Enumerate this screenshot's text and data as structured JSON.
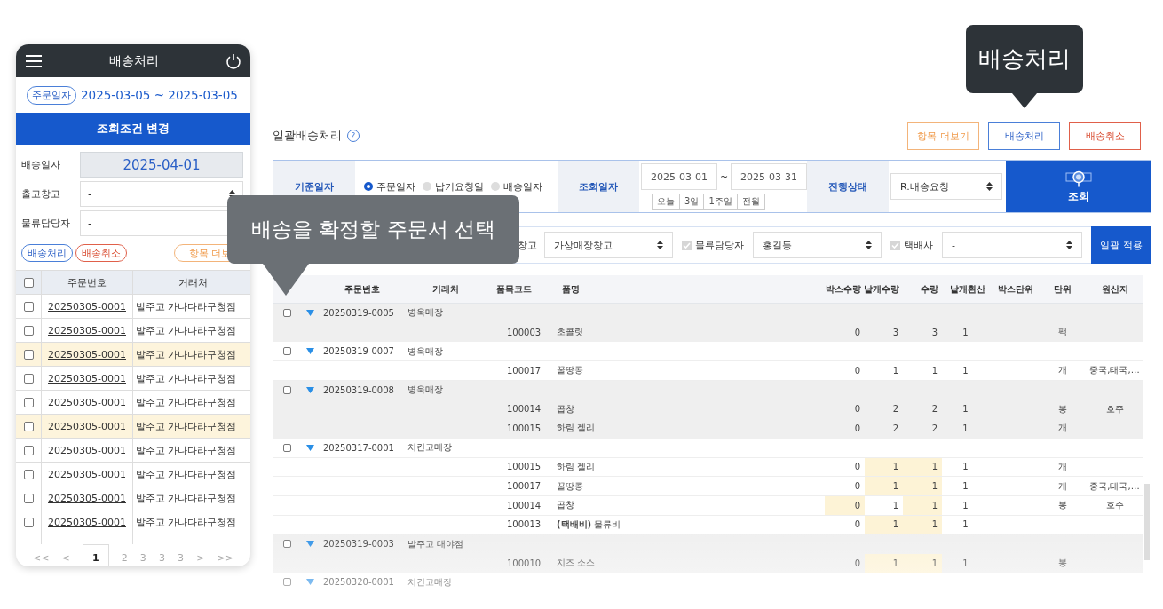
{
  "mobile": {
    "title": "배송처리",
    "date_filter": {
      "label": "주문일자",
      "range": "2025-03-05 ~ 2025-03-05"
    },
    "change_button": "조회조건 변경",
    "fields": [
      {
        "label": "배송일자",
        "value": "2025-04-01",
        "kind": "date"
      },
      {
        "label": "출고창고",
        "value": "-",
        "kind": "select"
      },
      {
        "label": "물류담당자",
        "value": "-",
        "kind": "text"
      }
    ],
    "buttons": [
      {
        "label": "배송처리",
        "kind": "primary"
      },
      {
        "label": "배송취소",
        "kind": "danger"
      },
      {
        "label": "항목 더보",
        "kind": "more"
      }
    ],
    "table": {
      "header_checked": false,
      "columns": [
        "주문번호",
        "거래처"
      ],
      "rows": [
        {
          "checked": false,
          "highlighted": false,
          "order_no": "20250305-0001",
          "customer": "발주고 가나다라구청점"
        },
        {
          "checked": false,
          "highlighted": false,
          "order_no": "20250305-0001",
          "customer": "발주고 가나다라구청점"
        },
        {
          "checked": false,
          "highlighted": true,
          "order_no": "20250305-0001",
          "customer": "발주고 가나다라구청점"
        },
        {
          "checked": false,
          "highlighted": false,
          "order_no": "20250305-0001",
          "customer": "발주고 가나다라구청점"
        },
        {
          "checked": false,
          "highlighted": false,
          "order_no": "20250305-0001",
          "customer": "발주고 가나다라구청점"
        },
        {
          "checked": false,
          "highlighted": true,
          "order_no": "20250305-0001",
          "customer": "발주고 가나다라구청점"
        },
        {
          "checked": false,
          "highlighted": false,
          "order_no": "20250305-0001",
          "customer": "발주고 가나다라구청점"
        },
        {
          "checked": false,
          "highlighted": false,
          "order_no": "20250305-0001",
          "customer": "발주고 가나다라구청점"
        },
        {
          "checked": false,
          "highlighted": false,
          "order_no": "20250305-0001",
          "customer": "발주고 가나다라구청점"
        },
        {
          "checked": false,
          "highlighted": false,
          "order_no": "20250305-0001",
          "customer": "발주고 가나다라구청점"
        }
      ]
    },
    "pagination": [
      {
        "label": "<<",
        "selected": false
      },
      {
        "label": "<",
        "selected": false
      },
      {
        "label": "1",
        "selected": true
      },
      {
        "label": "2",
        "selected": false
      },
      {
        "label": "3",
        "selected": false
      },
      {
        "label": "3",
        "selected": false
      },
      {
        "label": "3",
        "selected": false
      },
      {
        "label": ">",
        "selected": false
      },
      {
        "label": ">>",
        "selected": false
      }
    ]
  },
  "main": {
    "title": "일괄배송처리",
    "help": "?",
    "actions": [
      {
        "label": "항목 더보기",
        "kind": "more"
      },
      {
        "label": "배송처리",
        "kind": "primary"
      },
      {
        "label": "배송취소",
        "kind": "danger"
      }
    ],
    "filters": {
      "base_date": {
        "label": "기준일자",
        "options": [
          {
            "label": "주문일자",
            "selected": true
          },
          {
            "label": "납기요청일",
            "selected": false
          },
          {
            "label": "배송일자",
            "selected": false
          }
        ]
      },
      "query_date": {
        "label": "조회일자",
        "from": "2025-03-01",
        "separator": "~",
        "to": "2025-03-31",
        "quick": [
          "오늘",
          "3일",
          "1주일",
          "전월"
        ]
      },
      "status": {
        "label": "진행상태",
        "value": "R.배송요청"
      },
      "search_button": "조회"
    },
    "bulk": {
      "warehouse": {
        "label": "창고",
        "value": "가상매장창고"
      },
      "manager": {
        "label": "물류담당자",
        "checked": true,
        "value": "홍길동"
      },
      "courier": {
        "label": "택배사",
        "checked": true,
        "value": "-"
      },
      "apply_button": "일괄 적용"
    },
    "table": {
      "columns": [
        "주문번호",
        "거래처",
        "품목코드",
        "품명",
        "박스수량",
        "낱개수량",
        "수량",
        "낱개환산",
        "박스단위",
        "단위",
        "원산지"
      ],
      "orders": [
        {
          "checked": false,
          "order_no": "20250319-0005",
          "customer": "병욱매장",
          "items": [
            {
              "code": "100003",
              "name": "초콜릿",
              "box_qty": "0",
              "unit_qty": "3",
              "qty": "3",
              "unit_conv": "1",
              "unit": "팩",
              "edited": {
                "box_qty": false,
                "unit_qty": false,
                "qty": false
              }
            }
          ]
        },
        {
          "checked": false,
          "order_no": "20250319-0007",
          "customer": "병욱매장",
          "items": [
            {
              "code": "100017",
              "name": "꿀땅콩",
              "box_qty": "0",
              "unit_qty": "1",
              "qty": "1",
              "unit_conv": "1",
              "unit": "개",
              "origin": "중국,태국,…",
              "edited": {
                "box_qty": false,
                "unit_qty": false,
                "qty": false
              }
            }
          ]
        },
        {
          "checked": false,
          "order_no": "20250319-0008",
          "customer": "병욱매장",
          "items": [
            {
              "code": "100014",
              "name": "곱창",
              "box_qty": "0",
              "unit_qty": "2",
              "qty": "2",
              "unit_conv": "1",
              "unit": "봉",
              "origin": "호주",
              "edited": {
                "box_qty": false,
                "unit_qty": false,
                "qty": false
              }
            },
            {
              "code": "100015",
              "name": "하림 젤리",
              "box_qty": "0",
              "unit_qty": "2",
              "qty": "2",
              "unit_conv": "1",
              "unit": "개",
              "edited": {
                "box_qty": false,
                "unit_qty": false,
                "qty": false
              }
            }
          ]
        },
        {
          "checked": false,
          "order_no": "20250317-0001",
          "customer": "치킨고매장",
          "items": [
            {
              "code": "100015",
              "name": "하림 젤리",
              "box_qty": "0",
              "unit_qty": "1",
              "qty": "1",
              "unit_conv": "1",
              "unit": "개",
              "edited": {
                "box_qty": false,
                "unit_qty": true,
                "qty": true
              }
            },
            {
              "code": "100017",
              "name": "꿀땅콩",
              "box_qty": "0",
              "unit_qty": "1",
              "qty": "1",
              "unit_conv": "1",
              "unit": "개",
              "origin": "중국,태국,…",
              "edited": {
                "box_qty": false,
                "unit_qty": true,
                "qty": true
              }
            },
            {
              "code": "100014",
              "name": "곱창",
              "box_qty": "0",
              "unit_qty": "1",
              "qty": "1",
              "unit_conv": "1",
              "unit": "봉",
              "origin": "호주",
              "edited": {
                "box_qty": true,
                "unit_qty": false,
                "qty": true
              }
            },
            {
              "code": "100013",
              "name": "**(택배비)** 물류비",
              "box_qty": "0",
              "unit_qty": "1",
              "qty": "1",
              "unit_conv": "1",
              "edited": {
                "box_qty": false,
                "unit_qty": true,
                "qty": true
              }
            }
          ]
        },
        {
          "checked": false,
          "order_no": "20250319-0003",
          "customer": "발주고 대야점",
          "items": [
            {
              "code": "100010",
              "name": "치즈 소스",
              "box_qty": "0",
              "unit_qty": "1",
              "qty": "1",
              "unit_conv": "1",
              "unit": "봉",
              "edited": {
                "box_qty": false,
                "unit_qty": true,
                "qty": true
              }
            }
          ]
        },
        {
          "checked": false,
          "order_no": "20250320-0001",
          "customer": "치킨고매장"
        }
      ]
    }
  },
  "tooltips": [
    {
      "text": "배송처리"
    },
    {
      "text": "배송을 확정할 주문서 선택"
    }
  ]
}
